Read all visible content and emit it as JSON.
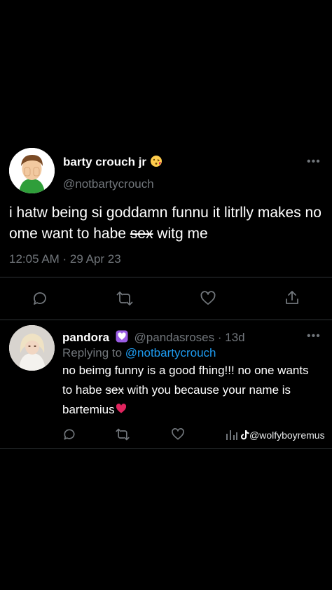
{
  "main_tweet": {
    "display_name": "barty crouch jr",
    "handle": "@notbartycrouch",
    "body_part1": "i hatw being si goddamn funnu it litrlly makes no ome want to habe ",
    "body_struck": "sex",
    "body_part2": " witg me",
    "timestamp": "12:05 AM · 29 Apr 23",
    "more_icon": "more-horizontal-icon",
    "actions": [
      "reply-icon",
      "retweet-icon",
      "like-icon",
      "share-icon"
    ]
  },
  "reply": {
    "display_name": "pandora",
    "handle_time": "@pandasroses · 13d",
    "replying_prefix": "Replying to ",
    "replying_handle": "@notbartycrouch",
    "body_part1": "no beimg funny is a good fhing!!! no one wants to habe ",
    "body_struck": "sex",
    "body_part2": " with you because your name is bartemius",
    "actions": [
      "reply-icon",
      "retweet-icon",
      "like-icon",
      "analytics-icon"
    ]
  },
  "watermark": {
    "text": "@wolfyboyremus",
    "icon": "tiktok-icon"
  }
}
